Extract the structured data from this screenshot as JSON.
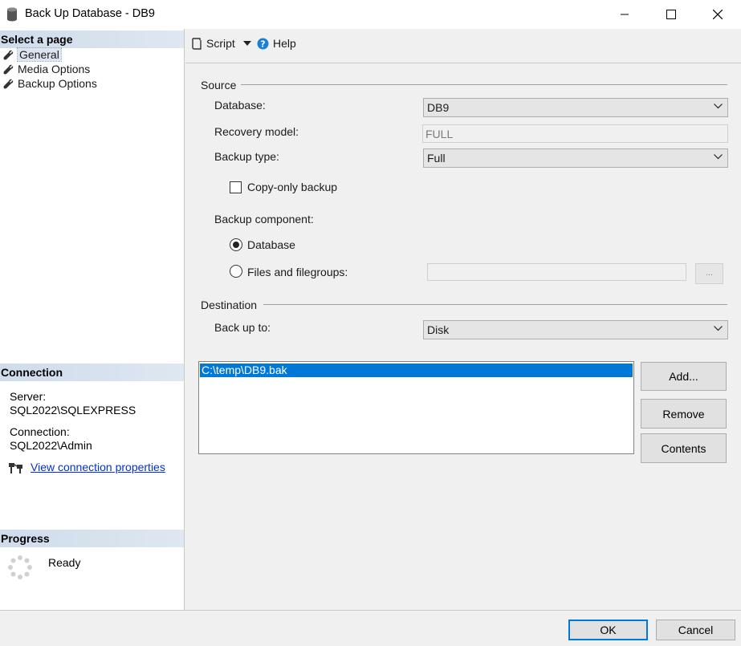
{
  "window": {
    "title": "Back Up Database - DB9",
    "icon": "database-icon"
  },
  "left": {
    "select_page": {
      "header": "Select a page",
      "items": [
        {
          "label": "General",
          "icon": "wrench-icon",
          "selected": true
        },
        {
          "label": "Media Options",
          "icon": "wrench-icon"
        },
        {
          "label": "Backup Options",
          "icon": "wrench-icon"
        }
      ]
    },
    "connection": {
      "header": "Connection",
      "server_label": "Server:",
      "server_value": "SQL2022\\SQLEXPRESS",
      "connection_label": "Connection:",
      "connection_value": "SQL2022\\Admin",
      "link": "View connection properties",
      "link_icon": "connection-properties-icon"
    },
    "progress": {
      "header": "Progress",
      "status": "Ready",
      "icon": "spinner-icon"
    }
  },
  "toolbar": {
    "script": "Script",
    "help": "Help"
  },
  "source": {
    "label": "Source",
    "database_label": "Database:",
    "database_value": "DB9",
    "recovery_label": "Recovery model:",
    "recovery_value": "FULL",
    "backup_type_label": "Backup type:",
    "backup_type_value": "Full",
    "copy_only_label": "Copy-only backup",
    "copy_only_checked": false,
    "component_label": "Backup component:",
    "component_database": "Database",
    "component_files": "Files and filegroups:",
    "selected_component": "Database",
    "browse_button": "..."
  },
  "destination": {
    "label": "Destination",
    "backup_to_label": "Back up to:",
    "backup_to_value": "Disk",
    "paths": [
      "C:\\temp\\DB9.bak"
    ],
    "add": "Add...",
    "remove": "Remove",
    "contents": "Contents"
  },
  "buttons": {
    "ok": "OK",
    "cancel": "Cancel"
  },
  "colors": {
    "selection": "#0078d7",
    "link": "#0033cc",
    "section_header": "#cfdcec"
  }
}
